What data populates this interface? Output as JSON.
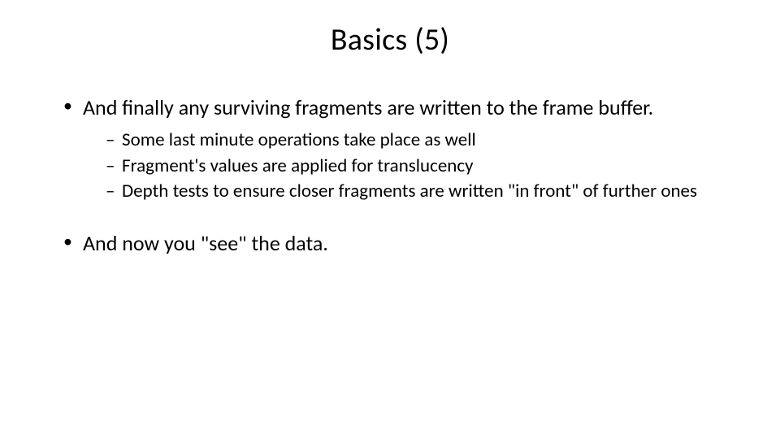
{
  "slide": {
    "title": "Basics (5)",
    "bullets": [
      {
        "text": "And finally any surviving fragments are written to the frame buffer.",
        "sub": [
          "Some last minute operations take place as well",
          "Fragment's values are applied for translucency",
          "Depth tests to ensure closer fragments are written \"in front\" of further ones"
        ]
      },
      {
        "text": "And now you \"see\" the data.",
        "sub": []
      }
    ]
  }
}
